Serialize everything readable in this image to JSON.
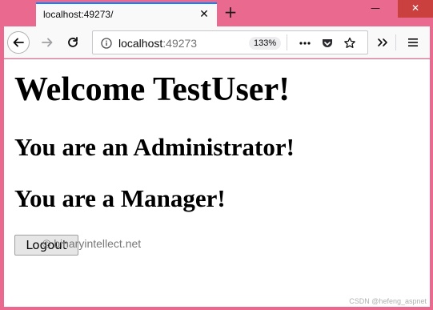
{
  "tab": {
    "title": "localhost:49273/",
    "close_glyph": "✕"
  },
  "new_tab_glyph": "+",
  "window_controls": {
    "minimize": "—",
    "maximize": "☐",
    "close": "✕"
  },
  "toolbar": {
    "url_host": "localhost",
    "url_port": ":49273",
    "zoom": "133%",
    "icons": [
      "back-arrow-icon",
      "forward-arrow-icon",
      "reload-icon",
      "info-icon",
      "more-dots-icon",
      "pocket-icon",
      "bookmark-star-icon",
      "overflow-chevrons-icon",
      "hamburger-menu-icon"
    ]
  },
  "page": {
    "heading": "Welcome TestUser!",
    "role_admin": "You are an Administrator!",
    "role_manager": "You are a Manager!",
    "logout_label": "Logout"
  },
  "watermarks": {
    "site": "© binaryintellect.net",
    "csdn": "CSDN @hefeng_aspnet"
  },
  "colors": {
    "frame": "#e9698f",
    "tab_accent": "#0a84ff",
    "close_button": "#c9403f",
    "page_bg": "#ffffff"
  }
}
